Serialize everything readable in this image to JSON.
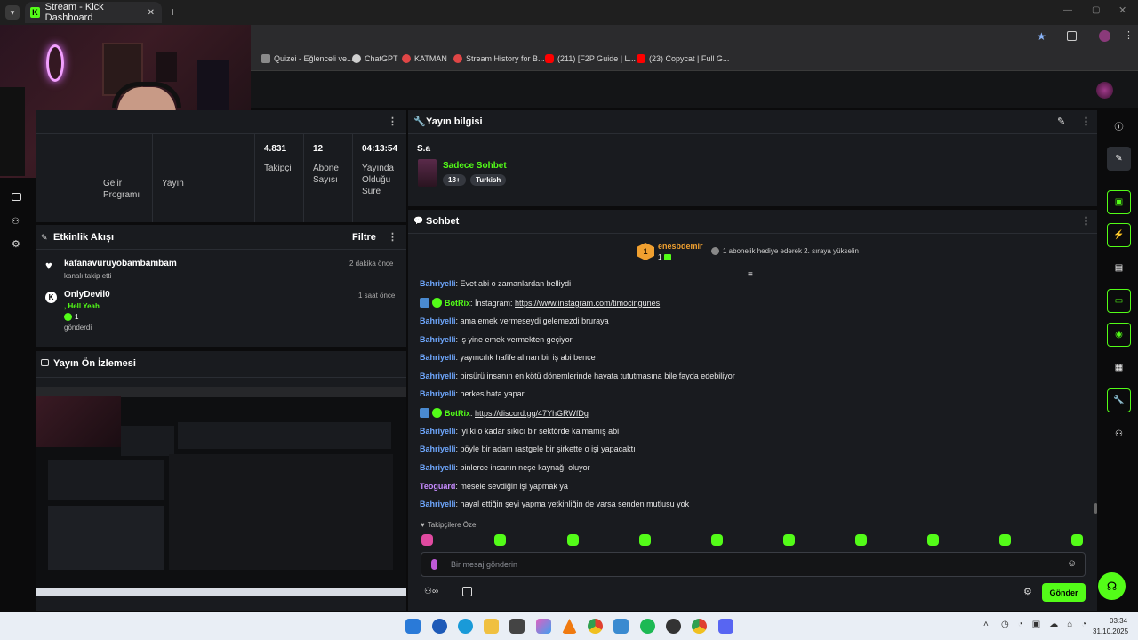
{
  "browser": {
    "tab_title": "Stream - Kick Dashboard",
    "new_tab_symbol": "+",
    "close_tab_symbol": "✕",
    "bookmarks": [
      {
        "label": "Quizei - Eğlenceli ve...",
        "color": "#8a8a8a"
      },
      {
        "label": "ChatGPT",
        "color": "#cfcfcf"
      },
      {
        "label": "KATMAN",
        "color": "#e04646"
      },
      {
        "label": "Stream History for B...",
        "color": "#e04646"
      },
      {
        "label": "(211) [F2P Guide | L...",
        "color": "#ff0000"
      },
      {
        "label": "(23) Copycat | Full G...",
        "color": "#ff0000"
      }
    ]
  },
  "stats_panel": {
    "items": [
      {
        "value": "",
        "label": "Gelir Programı"
      },
      {
        "value": "",
        "label": "Yayın"
      },
      {
        "value": "4.831",
        "label": "Takipçi"
      },
      {
        "value": "12",
        "label": "Abone Sayısı"
      },
      {
        "value": "04:13:54",
        "label": "Yayında Olduğu Süre"
      }
    ]
  },
  "activity": {
    "title": "Etkinlik Akışı",
    "filter_label": "Filtre",
    "events": [
      {
        "name": "kafanavuruyobambambam",
        "detail": "kanalı takip etti",
        "time": "2 dakika önce"
      },
      {
        "name": "OnlyDevil0",
        "message": ", Hell Yeah",
        "count": "1",
        "detail": "gönderdi",
        "time": "1 saat önce"
      }
    ]
  },
  "preview": {
    "title": "Yayın Ön İzlemesi"
  },
  "stream_info": {
    "title": "Yayın bilgisi",
    "stream_title": "S.a",
    "category": "Sadece Sohbet",
    "tags": [
      "18+",
      "Turkish"
    ]
  },
  "chat": {
    "title": "Sohbet",
    "pinned_user": "enesbdemir",
    "pinned_rank": "1",
    "pinned_count": "1",
    "pinned_notice": "1 abonelik hediye ederek 2. sıraya yükselin",
    "messages": [
      {
        "user": "Bahriyelli",
        "type": "user",
        "text": "Evet abi o zamanlardan belliydi"
      },
      {
        "user": "BotRix",
        "type": "bot",
        "prefix": "İnstagram: ",
        "link": "https://www.instagram.com/timocingunes"
      },
      {
        "user": "Bahriyelli",
        "type": "user",
        "text": "ama emek vermeseydi gelemezdi bruraya"
      },
      {
        "user": "Bahriyelli",
        "type": "user",
        "text": "iş yine emek vermekten geçiyor"
      },
      {
        "user": "Bahriyelli",
        "type": "user",
        "text": "yayıncılık hafife alınan bir iş abi bence"
      },
      {
        "user": "Bahriyelli",
        "type": "user",
        "text": "birsürü insanın en kötü dönemlerinde hayata tututmasına bile fayda edebiliyor"
      },
      {
        "user": "Bahriyelli",
        "type": "user",
        "text": "herkes hata yapar"
      },
      {
        "user": "BotRix",
        "type": "bot",
        "prefix": "",
        "link": "https://discord.gg/47YhGRWfDg"
      },
      {
        "user": "Bahriyelli",
        "type": "user",
        "text": "iyi ki o kadar sıkıcı bir sektörde kalmamış abi"
      },
      {
        "user": "Bahriyelli",
        "type": "user",
        "text": "böyle bir adam rastgele bir şirkette o işi yapacaktı"
      },
      {
        "user": "Bahriyelli",
        "type": "user",
        "text": "binlerce insanın neşe kaynağı oluyor"
      },
      {
        "user": "Teoguard",
        "type": "mod",
        "text": "mesele sevdiğin işi yapmak ya"
      },
      {
        "user": "Bahriyelli",
        "type": "user",
        "text": "hayal ettiğin şeyi yapma yetkinliğin de varsa senden mutlusu yok"
      }
    ],
    "followers_only": "Takipçilere Özel",
    "input_placeholder": "Bir mesaj gönderin",
    "send_label": "Gönder"
  },
  "taskbar": {
    "time": "03:34",
    "date": "31.10.2025"
  },
  "colors": {
    "kick_green": "#53fc18",
    "panel_bg": "#191b1f",
    "chat_user": "#6fa8ff"
  }
}
